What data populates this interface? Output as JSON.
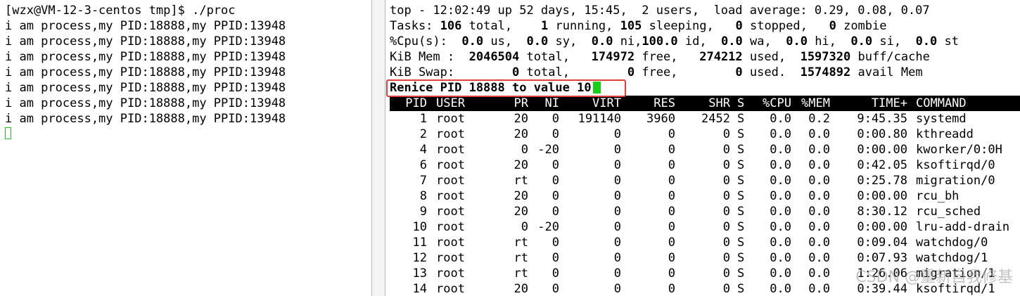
{
  "left": {
    "prompt_line": "[wzx@VM-12-3-centos tmp]$ ./proc",
    "output_lines": [
      "i am process,my PID:18888,my PPID:13948",
      "i am process,my PID:18888,my PPID:13948",
      "i am process,my PID:18888,my PPID:13948",
      "i am process,my PID:18888,my PPID:13948",
      "i am process,my PID:18888,my PPID:13948",
      "i am process,my PID:18888,my PPID:13948",
      "i am process,my PID:18888,my PPID:13948"
    ]
  },
  "top": {
    "line1": "top - 12:02:49 up 52 days, 15:45,  2 users,  load average: 0.29, 0.08, 0.07",
    "tasks": {
      "label": "Tasks:",
      "total": "106",
      "total_lbl": "total,",
      "running": "1",
      "running_lbl": "running,",
      "sleeping": "105",
      "sleeping_lbl": "sleeping,",
      "stopped": "0",
      "stopped_lbl": "stopped,",
      "zombie": "0",
      "zombie_lbl": "zombie"
    },
    "cpu": {
      "label": "%Cpu(s):",
      "us": "0.0",
      "us_lbl": "us,",
      "sy": "0.0",
      "sy_lbl": "sy,",
      "ni": "0.0",
      "ni_lbl": "ni,",
      "id": "100.0",
      "id_lbl": "id,",
      "wa": "0.0",
      "wa_lbl": "wa,",
      "hi": "0.0",
      "hi_lbl": "hi,",
      "si": "0.0",
      "si_lbl": "si,",
      "st": "0.0",
      "st_lbl": "st"
    },
    "mem": {
      "label": "KiB Mem :",
      "total": "2046504",
      "total_lbl": "total,",
      "free": "174972",
      "free_lbl": "free,",
      "used": "274212",
      "used_lbl": "used,",
      "buff": "1597320",
      "buff_lbl": "buff/cache"
    },
    "swap": {
      "label": "KiB Swap:",
      "total": "0",
      "total_lbl": "total,",
      "free": "0",
      "free_lbl": "free,",
      "used": "0",
      "used_lbl": "used.",
      "avail": "1574892",
      "avail_lbl": "avail Mem"
    },
    "renice_prompt": "Renice PID 18888 to value ",
    "renice_input": "10",
    "columns": [
      "PID",
      "USER",
      "PR",
      "NI",
      "VIRT",
      "RES",
      "SHR",
      "S",
      "%CPU",
      "%MEM",
      "TIME+",
      "COMMAND"
    ],
    "rows": [
      [
        "1",
        "root",
        "20",
        "0",
        "191140",
        "3960",
        "2452",
        "S",
        "0.0",
        "0.2",
        "9:45.35",
        "systemd"
      ],
      [
        "2",
        "root",
        "20",
        "0",
        "0",
        "0",
        "0",
        "S",
        "0.0",
        "0.0",
        "0:00.80",
        "kthreadd"
      ],
      [
        "4",
        "root",
        "0",
        "-20",
        "0",
        "0",
        "0",
        "S",
        "0.0",
        "0.0",
        "0:00.00",
        "kworker/0:0H"
      ],
      [
        "6",
        "root",
        "20",
        "0",
        "0",
        "0",
        "0",
        "S",
        "0.0",
        "0.0",
        "0:42.05",
        "ksoftirqd/0"
      ],
      [
        "7",
        "root",
        "rt",
        "0",
        "0",
        "0",
        "0",
        "S",
        "0.0",
        "0.0",
        "0:25.78",
        "migration/0"
      ],
      [
        "8",
        "root",
        "20",
        "0",
        "0",
        "0",
        "0",
        "S",
        "0.0",
        "0.0",
        "0:00.00",
        "rcu_bh"
      ],
      [
        "9",
        "root",
        "20",
        "0",
        "0",
        "0",
        "0",
        "S",
        "0.0",
        "0.0",
        "8:30.12",
        "rcu_sched"
      ],
      [
        "10",
        "root",
        "0",
        "-20",
        "0",
        "0",
        "0",
        "S",
        "0.0",
        "0.0",
        "0:00.00",
        "lru-add-drain"
      ],
      [
        "11",
        "root",
        "rt",
        "0",
        "0",
        "0",
        "0",
        "S",
        "0.0",
        "0.0",
        "0:09.04",
        "watchdog/0"
      ],
      [
        "12",
        "root",
        "rt",
        "0",
        "0",
        "0",
        "0",
        "S",
        "0.0",
        "0.0",
        "0:07.93",
        "watchdog/1"
      ],
      [
        "13",
        "root",
        "rt",
        "0",
        "0",
        "0",
        "0",
        "S",
        "0.0",
        "0.0",
        "1:26.06",
        "migration/1"
      ],
      [
        "14",
        "root",
        "20",
        "0",
        "0",
        "0",
        "0",
        "S",
        "0.0",
        "0.0",
        "0:39.44",
        "ksoftirqd/1"
      ]
    ]
  },
  "watermark": "CSDN @重新自我修基",
  "colors": {
    "highlight_box": "#e0403a",
    "cursor": "#16d216",
    "header_bg": "#000000"
  }
}
